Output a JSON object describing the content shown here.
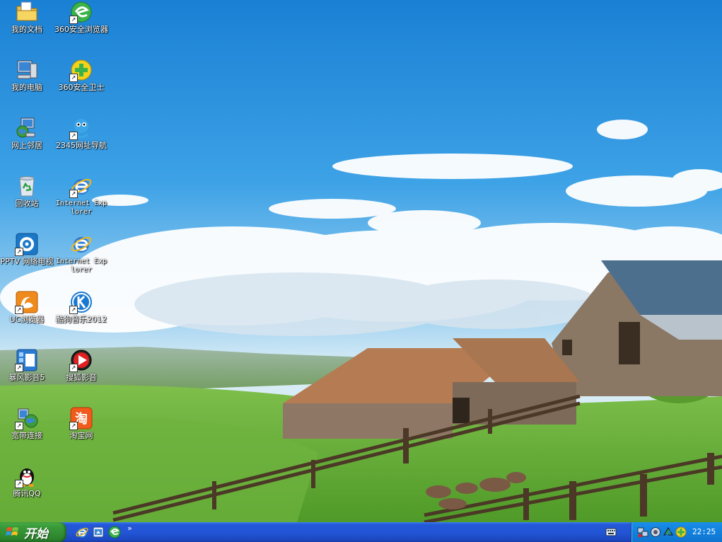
{
  "desktop": {
    "icons": [
      {
        "label": "我的文档",
        "icon": "my-documents-icon",
        "shortcut": false
      },
      {
        "label": "360安全浏览器",
        "icon": "360-browser-icon",
        "shortcut": true
      },
      {
        "label": "我的电脑",
        "icon": "my-computer-icon",
        "shortcut": false
      },
      {
        "label": "360安全卫士",
        "icon": "360-safeguard-icon",
        "shortcut": true
      },
      {
        "label": "网上邻居",
        "icon": "network-places-icon",
        "shortcut": false
      },
      {
        "label": "2345网址导航",
        "icon": "2345-nav-icon",
        "shortcut": true
      },
      {
        "label": "回收站",
        "icon": "recycle-bin-icon",
        "shortcut": false
      },
      {
        "label": "Internet Explorer",
        "icon": "ie-icon",
        "shortcut": true
      },
      {
        "label": "PPTV 网络电视",
        "icon": "pptv-icon",
        "shortcut": true
      },
      {
        "label": "Internet Explorer",
        "icon": "ie-icon",
        "shortcut": false
      },
      {
        "label": "UC浏览器",
        "icon": "uc-browser-icon",
        "shortcut": true
      },
      {
        "label": "酷狗音乐2012",
        "icon": "kugou-icon",
        "shortcut": true
      },
      {
        "label": "暴风影音5",
        "icon": "baofeng-icon",
        "shortcut": true
      },
      {
        "label": "搜狐影音",
        "icon": "sohu-video-icon",
        "shortcut": true
      },
      {
        "label": "宽带连接",
        "icon": "broadband-icon",
        "shortcut": true
      },
      {
        "label": "淘宝网",
        "icon": "taobao-icon",
        "shortcut": true
      },
      {
        "label": "腾讯QQ",
        "icon": "qq-icon",
        "shortcut": true
      }
    ]
  },
  "taskbar": {
    "start_label": "开始",
    "quick_launch": [
      "ie-icon",
      "desktop-show-icon",
      "360-browser-icon"
    ],
    "quick_more": "»",
    "clock": "22:25"
  },
  "colors": {
    "taskbar_blue": "#2256d6",
    "start_green": "#3a9c3a",
    "tray_blue": "#1383e0"
  }
}
